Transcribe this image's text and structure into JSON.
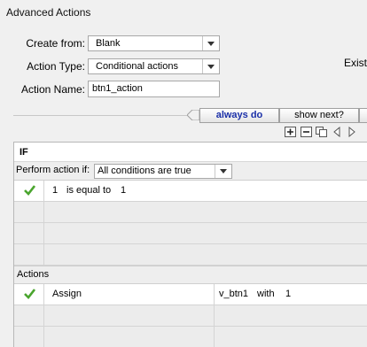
{
  "window": {
    "title": "Advanced Actions"
  },
  "form": {
    "create_from_label": "Create from:",
    "create_from_value": "Blank",
    "action_type_label": "Action Type:",
    "action_type_value": "Conditional actions",
    "action_name_label": "Action Name:",
    "action_name_value": "btn1_action",
    "existing_label": "Existi"
  },
  "tabs": [
    {
      "label": "always do",
      "active": true
    },
    {
      "label": "show next?",
      "active": false
    }
  ],
  "toolbar": [
    "add-icon",
    "remove-icon",
    "copy-icon",
    "arrow-left-icon",
    "arrow-right-icon"
  ],
  "if_section": {
    "header": "IF",
    "perform_label": "Perform action if:",
    "perform_value": "All conditions are true",
    "conditions": [
      {
        "checked": true,
        "left": "1",
        "op": "is equal to",
        "right": "1"
      }
    ]
  },
  "actions_section": {
    "header": "Actions",
    "rows": [
      {
        "checked": true,
        "action": "Assign",
        "target": "v_btn1",
        "with_word": "with",
        "value": "1"
      }
    ]
  }
}
